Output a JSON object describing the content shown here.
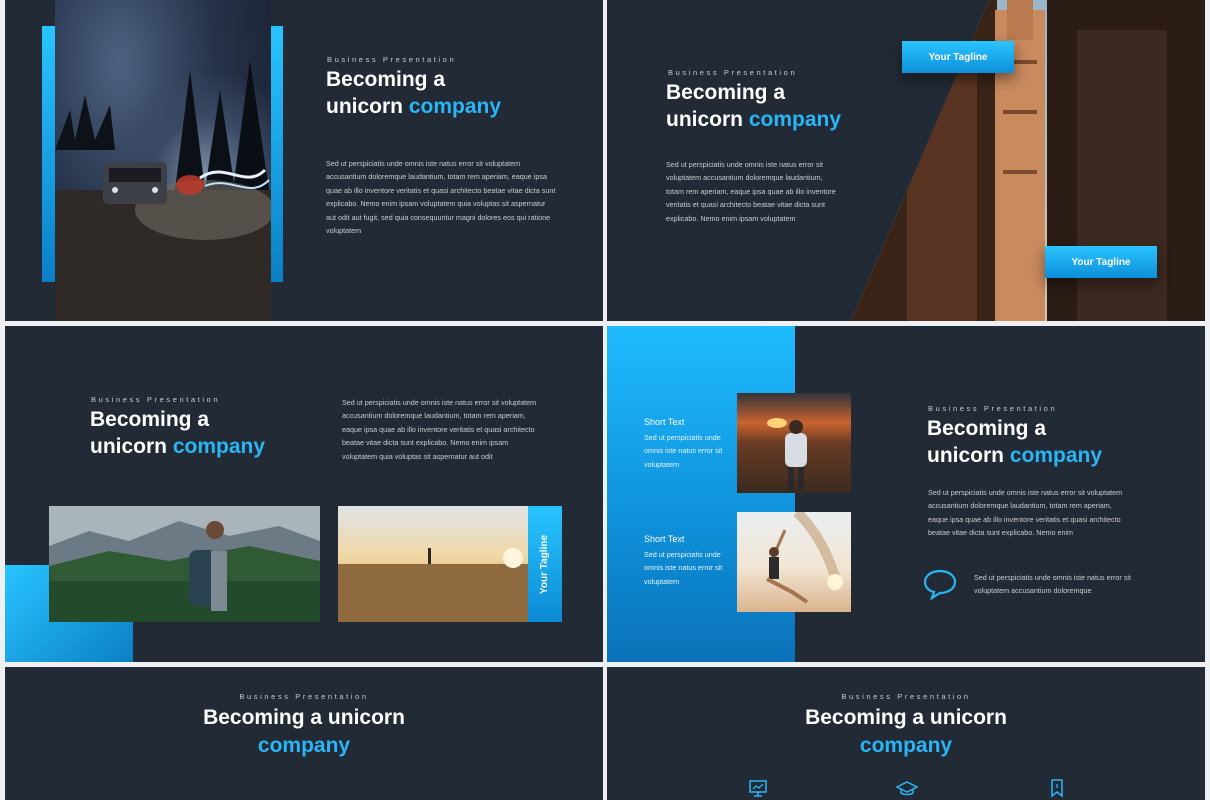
{
  "slides": {
    "s1": {
      "eyebrow": "Business Presentation",
      "title_line1": "Becoming a",
      "title_line2_plain": "unicorn ",
      "title_line2_accent": "company",
      "body": "Sed ut perspiciatis unde omnis iste natus error sit voluptatem accusantium doloremque laudantium, totam rem aperiam, eaque ipsa quae ab illo inventore veritatis et quasi architecto beatae vitae dicta sunt  explicabo. Nemo enim ipsam voluptatem quia voluptas sit aspernatur aut odit aut fugit, sed quia consequuntur  magni dolores eos qui ratione voluptatem"
    },
    "s2": {
      "eyebrow": "Business Presentation",
      "title_line1": "Becoming a",
      "title_line2_plain": "unicorn ",
      "title_line2_accent": "company",
      "body": "Sed ut perspiciatis unde omnis iste natus error sit voluptatem accusantium doloremque laudantium, totam rem aperiam, eaque ipsa quae ab illo inventore veritatis et quasi architecto beatae vitae dicta sunt  explicabo. Nemo enim ipsam voluptatem",
      "tagline_top": "Your Tagline",
      "tagline_bottom": "Your Tagline"
    },
    "s3": {
      "eyebrow": "Business Presentation",
      "title_line1": "Becoming a",
      "title_line2_plain": "unicorn ",
      "title_line2_accent": "company",
      "body": "Sed ut perspiciatis unde omnis iste natus error sit voluptatem accusantium doloremque laudantium, totam rem aperiam, eaque ipsa quae ab illo inventore veritatis et quasi architecto beatae vitae dicta sunt explicabo. Nemo enim ipsam voluptatem quia voluptas sit aspernatur aut odit",
      "tagline": "Your Tagline"
    },
    "s4": {
      "eyebrow": "Business Presentation",
      "title_line1": "Becoming a",
      "title_line2_plain": "unicorn ",
      "title_line2_accent": "company",
      "body": "Sed ut perspiciatis unde omnis iste natus error sit voluptatem accusantium doloremque laudantium, totam rem aperiam, eaque ipsa quae ab illo inventore veritatis et quasi architecto beatae vitae dicta sunt  explicabo. Nemo enim",
      "short1_title": "Short Text",
      "short1_body": "Sed ut perspiciatis unde omnis iste natus error sit voluptatem",
      "short2_title": "Short Text",
      "short2_body": "Sed ut perspiciatis unde omnis iste natus error sit voluptatem",
      "quote_body": "Sed ut perspiciatis unde omnis iste natus error sit voluptatem accusantium doloremque"
    },
    "s5": {
      "eyebrow": "Business Presentation",
      "title_line1": "Becoming a unicorn",
      "title_line2": "company"
    },
    "s6": {
      "eyebrow": "Business Presentation",
      "title_line1": "Becoming a unicorn",
      "title_line2": "company",
      "icons": [
        "presentation-board-icon",
        "graduation-cap-icon",
        "bookmark-icon"
      ]
    }
  },
  "colors": {
    "background": "#222a36",
    "accent": "#29b6f6",
    "page": "#eef0f3"
  }
}
